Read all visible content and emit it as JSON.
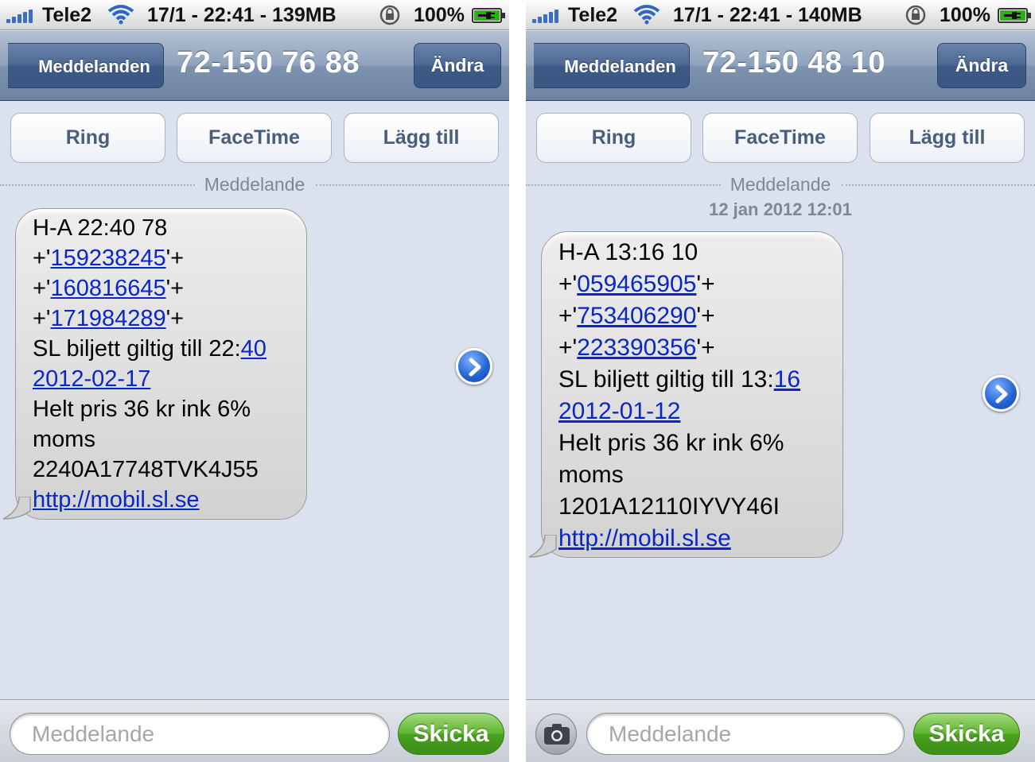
{
  "colors": {
    "link": "#0a27c6",
    "background": "#dbe2ed",
    "navbar": "#6d84a2",
    "send_button": "#4aa11f"
  },
  "left": {
    "statusbar": {
      "carrier": "Tele2",
      "center": "17/1 - 22:41 - 139MB",
      "battery": "100%"
    },
    "nav": {
      "back": "Meddelanden",
      "title": "72-150 76 88",
      "edit": "Ändra"
    },
    "actions": {
      "call": "Ring",
      "facetime": "FaceTime",
      "add": "Lägg till"
    },
    "header": "Meddelande",
    "message": {
      "l1": "H-A 22:40 78",
      "plus": "+'",
      "quote_plus": "'+",
      "n1": "159238245",
      "n2": "160816645",
      "n3": "171984289",
      "valid_prefix": "SL biljett giltig till 22:",
      "valid_link_a": "40 ",
      "valid_link_b": "2012-02-17",
      "price_a": "Helt pris 36 kr ink 6%",
      "price_b": "moms",
      "code": "2240A17748TVK4J55",
      "url": "http://mobil.sl.se"
    },
    "input": {
      "placeholder": "Meddelande",
      "send": "Skicka"
    }
  },
  "right": {
    "statusbar": {
      "carrier": "Tele2",
      "center": "17/1 - 22:41 - 140MB",
      "battery": "100%"
    },
    "nav": {
      "back": "Meddelanden",
      "title": "72-150 48 10",
      "edit": "Ändra"
    },
    "actions": {
      "call": "Ring",
      "facetime": "FaceTime",
      "add": "Lägg till"
    },
    "header": "Meddelande",
    "timestamp": "12 jan 2012 12:01",
    "message": {
      "l1": "H-A 13:16 10",
      "plus": "+'",
      "quote_plus": "'+",
      "n1": "059465905",
      "n2": "753406290",
      "n3": "223390356",
      "valid_prefix": "SL biljett giltig till 13:",
      "valid_link_a": "16 ",
      "valid_link_b": "2012-01-12",
      "price_a": "Helt pris 36 kr ink 6%",
      "price_b": "moms",
      "code": "1201A12110IYVY46I",
      "url": "http://mobil.sl.se"
    },
    "input": {
      "placeholder": "Meddelande",
      "send": "Skicka"
    }
  }
}
